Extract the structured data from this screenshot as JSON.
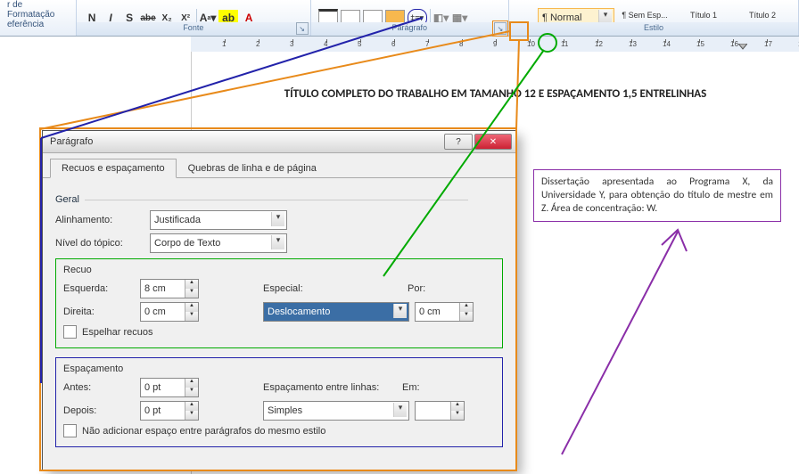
{
  "ribbon": {
    "sidebar": {
      "l1": "r de Formatação",
      "l2": "eferência"
    },
    "fonte_label": "Fonte",
    "font_buttons": [
      "N",
      "I",
      "S",
      "abe",
      "X₂",
      "X²"
    ],
    "paragrafo_label": "Parágrafo",
    "estilo_label": "Estilo",
    "styles": [
      {
        "preview": "",
        "name": "",
        "sel": false,
        "half": true
      },
      {
        "preview": "",
        "name": "¶ Normal",
        "sel": true
      },
      {
        "preview": "",
        "name": "¶ Sem Esp...",
        "sel": false
      },
      {
        "preview": "",
        "name": "Título 1",
        "sel": false
      },
      {
        "preview": "",
        "name": "Título 2",
        "sel": false
      }
    ]
  },
  "doc": {
    "title": "TÍTULO COMPLETO DO TRABALHO EM TAMANHO 12 E ESPAÇAMENTO 1,5 ENTRELINHAS",
    "body": "Dissertação apresentada ao Programa X, da Universidade Y, para obtenção do título de mestre em Z. Área de concentração: W."
  },
  "dialog": {
    "title": "Parágrafo",
    "tabs": {
      "a": "Recuos e espaçamento",
      "b": "Quebras de linha e de página"
    },
    "geral": {
      "label": "Geral",
      "alinhamento_lbl": "Alinhamento:",
      "alinhamento_val": "Justificada",
      "nivel_lbl": "Nível do tópico:",
      "nivel_val": "Corpo de Texto"
    },
    "recuo": {
      "label": "Recuo",
      "esquerda_lbl": "Esquerda:",
      "esquerda_val": "8 cm",
      "direita_lbl": "Direita:",
      "direita_val": "0 cm",
      "especial_lbl": "Especial:",
      "especial_val": "Deslocamento",
      "por_lbl": "Por:",
      "por_val": "0 cm",
      "espelhar": "Espelhar recuos"
    },
    "esp": {
      "label": "Espaçamento",
      "antes_lbl": "Antes:",
      "antes_val": "0 pt",
      "depois_lbl": "Depois:",
      "depois_val": "0 pt",
      "entre_lbl": "Espaçamento entre linhas:",
      "entre_val": "Simples",
      "em_lbl": "Em:",
      "em_val": "",
      "naoadd": "Não adicionar espaço entre parágrafos do mesmo estilo"
    }
  }
}
